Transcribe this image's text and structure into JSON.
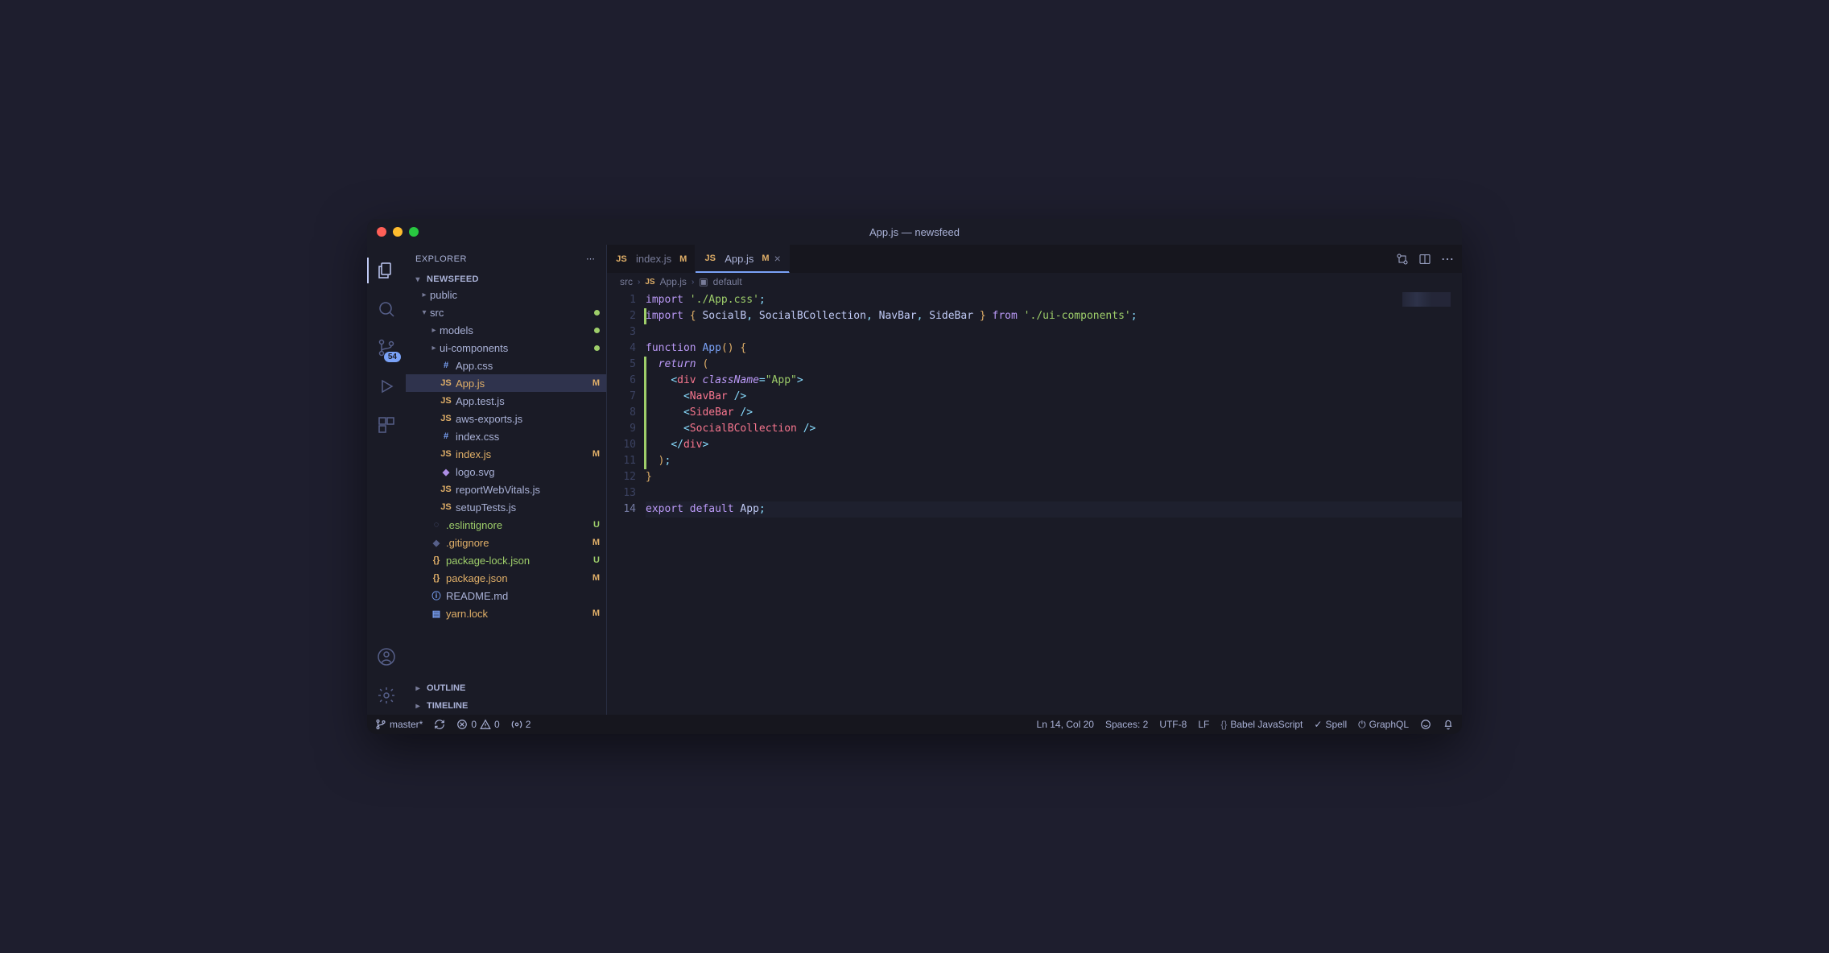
{
  "window": {
    "title": "App.js — newsfeed"
  },
  "sidebar": {
    "explorer_label": "EXPLORER",
    "project_label": "NEWSFEED",
    "outline_label": "OUTLINE",
    "timeline_label": "TIMELINE"
  },
  "activity": {
    "scm_badge": "54"
  },
  "tree": {
    "items": [
      {
        "label": "public",
        "type": "folder",
        "indent": 1,
        "chev": "right"
      },
      {
        "label": "src",
        "type": "folder",
        "indent": 1,
        "chev": "down",
        "dot": true
      },
      {
        "label": "models",
        "type": "folder",
        "indent": 2,
        "chev": "right",
        "dot": true
      },
      {
        "label": "ui-components",
        "type": "folder",
        "indent": 2,
        "chev": "right",
        "dot": true
      },
      {
        "label": "App.css",
        "type": "file",
        "icon": "#",
        "iconClass": "ic-css",
        "indent": 2
      },
      {
        "label": "App.js",
        "type": "file",
        "icon": "JS",
        "iconClass": "ic-js",
        "indent": 2,
        "status": "M",
        "selected": true
      },
      {
        "label": "App.test.js",
        "type": "file",
        "icon": "JS",
        "iconClass": "ic-js",
        "indent": 2
      },
      {
        "label": "aws-exports.js",
        "type": "file",
        "icon": "JS",
        "iconClass": "ic-js",
        "indent": 2
      },
      {
        "label": "index.css",
        "type": "file",
        "icon": "#",
        "iconClass": "ic-css",
        "indent": 2
      },
      {
        "label": "index.js",
        "type": "file",
        "icon": "JS",
        "iconClass": "ic-js",
        "indent": 2,
        "status": "M"
      },
      {
        "label": "logo.svg",
        "type": "file",
        "icon": "◆",
        "iconClass": "ic-svg",
        "indent": 2
      },
      {
        "label": "reportWebVitals.js",
        "type": "file",
        "icon": "JS",
        "iconClass": "ic-js",
        "indent": 2
      },
      {
        "label": "setupTests.js",
        "type": "file",
        "icon": "JS",
        "iconClass": "ic-js",
        "indent": 2
      },
      {
        "label": ".eslintignore",
        "type": "file",
        "icon": "◌",
        "iconClass": "ic-ign",
        "indent": 1,
        "status": "U"
      },
      {
        "label": ".gitignore",
        "type": "file",
        "icon": "◆",
        "iconClass": "ic-ign",
        "indent": 1,
        "status": "M"
      },
      {
        "label": "package-lock.json",
        "type": "file",
        "icon": "{}",
        "iconClass": "ic-json",
        "indent": 1,
        "status": "U"
      },
      {
        "label": "package.json",
        "type": "file",
        "icon": "{}",
        "iconClass": "ic-json",
        "indent": 1,
        "status": "M"
      },
      {
        "label": "README.md",
        "type": "file",
        "icon": "ⓘ",
        "iconClass": "ic-info",
        "indent": 1
      },
      {
        "label": "yarn.lock",
        "type": "file",
        "icon": "▤",
        "iconClass": "ic-file",
        "indent": 1,
        "status": "M"
      }
    ]
  },
  "tabs": [
    {
      "label": "index.js",
      "status": "M",
      "active": false
    },
    {
      "label": "App.js",
      "status": "M",
      "active": true,
      "closable": true
    }
  ],
  "breadcrumb": {
    "seg0": "src",
    "seg1": "App.js",
    "seg2": "default"
  },
  "code": {
    "lines": [
      {
        "n": "1",
        "html": "<span class='tok-kw2'>import</span> <span class='tok-str'>'./App.css'</span><span class='tok-punc'>;</span>"
      },
      {
        "n": "2",
        "html": "<span class='tok-kw2'>import</span> <span class='tok-brace'>{</span> <span class='tok-id'>SocialB</span><span class='tok-punc'>,</span> <span class='tok-id'>SocialBCollection</span><span class='tok-punc'>,</span> <span class='tok-id'>NavBar</span><span class='tok-punc'>,</span> <span class='tok-id'>SideBar</span> <span class='tok-brace'>}</span> <span class='tok-kw2'>from</span> <span class='tok-str'>'./ui-components'</span><span class='tok-punc'>;</span>",
        "git": true
      },
      {
        "n": "3",
        "html": ""
      },
      {
        "n": "4",
        "html": "<span class='tok-kw2'>function</span> <span class='tok-fn'>App</span><span class='tok-brace'>()</span> <span class='tok-brace'>{</span>"
      },
      {
        "n": "5",
        "html": "  <span class='tok-kw'>return</span> <span class='tok-brace'>(</span>",
        "git": true
      },
      {
        "n": "6",
        "html": "    <span class='tok-punc'>&lt;</span><span class='tok-tag'>div</span> <span class='tok-attr'>className</span><span class='tok-punc'>=</span><span class='tok-str'>\"App\"</span><span class='tok-punc'>&gt;</span>",
        "git": true
      },
      {
        "n": "7",
        "html": "      <span class='tok-punc'>&lt;</span><span class='tok-comp'>NavBar</span> <span class='tok-punc'>/&gt;</span>",
        "git": true
      },
      {
        "n": "8",
        "html": "      <span class='tok-punc'>&lt;</span><span class='tok-comp'>SideBar</span> <span class='tok-punc'>/&gt;</span>",
        "git": true
      },
      {
        "n": "9",
        "html": "      <span class='tok-punc'>&lt;</span><span class='tok-comp'>SocialBCollection</span> <span class='tok-punc'>/&gt;</span>",
        "git": true
      },
      {
        "n": "10",
        "html": "    <span class='tok-punc'>&lt;/</span><span class='tok-tag'>div</span><span class='tok-punc'>&gt;</span>",
        "git": true
      },
      {
        "n": "11",
        "html": "  <span class='tok-brace'>)</span><span class='tok-punc'>;</span>",
        "git": true
      },
      {
        "n": "12",
        "html": "<span class='tok-brace'>}</span>"
      },
      {
        "n": "13",
        "html": ""
      },
      {
        "n": "14",
        "html": "<span class='tok-kw2'>export</span> <span class='tok-kw2'>default</span> <span class='tok-id'>App</span><span class='tok-punc'>;</span>",
        "current": true
      }
    ]
  },
  "status": {
    "branch": "master*",
    "errors": "0",
    "warnings": "0",
    "ports": "2",
    "cursor": "Ln 14, Col 20",
    "spaces": "Spaces: 2",
    "encoding": "UTF-8",
    "eol": "LF",
    "language": "Babel JavaScript",
    "spell": "Spell",
    "graphql": "GraphQL"
  }
}
